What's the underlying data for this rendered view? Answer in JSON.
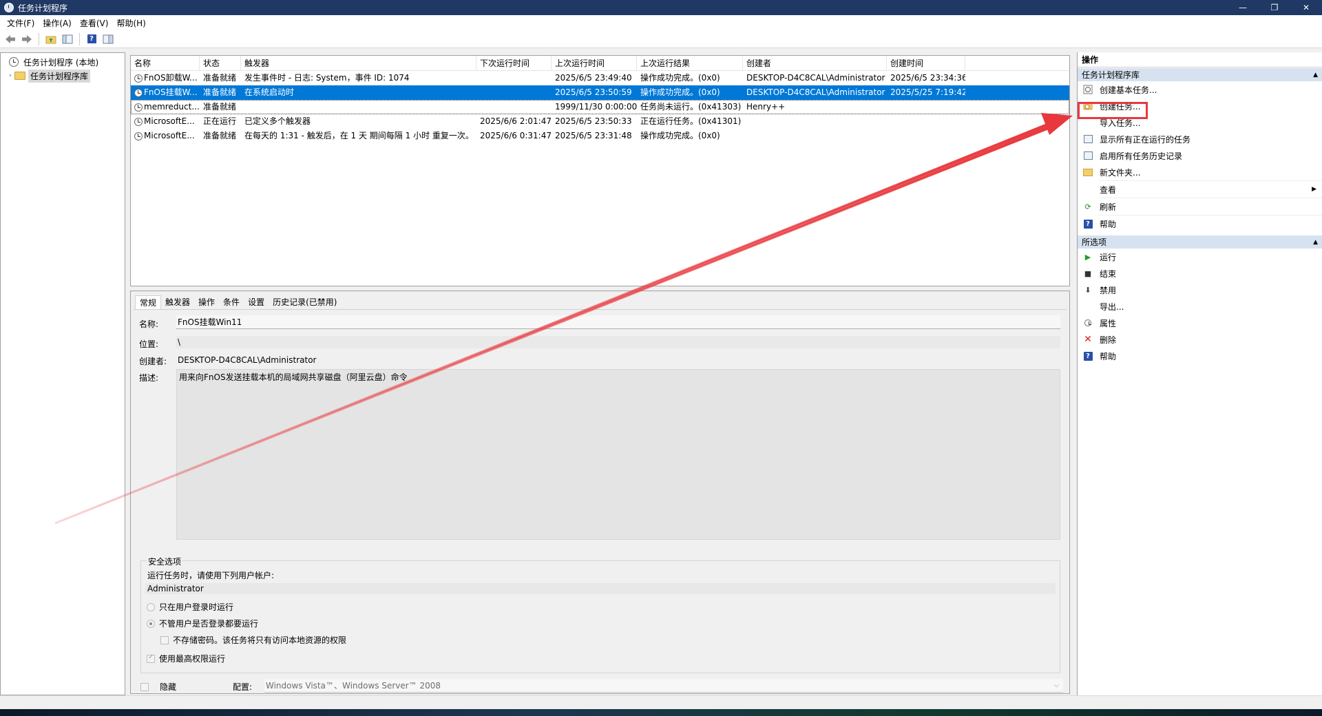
{
  "window": {
    "title": "任务计划程序",
    "minimize": "—",
    "restore": "❐",
    "close": "✕"
  },
  "menu": [
    "文件(F)",
    "操作(A)",
    "查看(V)",
    "帮助(H)"
  ],
  "tree": {
    "root": "任务计划程序 (本地)",
    "library": "任务计划程序库"
  },
  "task_list": {
    "columns": [
      "名称",
      "状态",
      "触发器",
      "下次运行时间",
      "上次运行时间",
      "上次运行结果",
      "创建者",
      "创建时间"
    ],
    "rows": [
      [
        "FnOS卸载W...",
        "准备就绪",
        "发生事件时 - 日志: System，事件 ID: 1074",
        "",
        "2025/6/5 23:49:40",
        "操作成功完成。(0x0)",
        "DESKTOP-D4C8CAL\\Administrator",
        "2025/6/5 23:34:36"
      ],
      [
        "FnOS挂载W...",
        "准备就绪",
        "在系统启动时",
        "",
        "2025/6/5 23:50:59",
        "操作成功完成。(0x0)",
        "DESKTOP-D4C8CAL\\Administrator",
        "2025/5/25 7:19:42"
      ],
      [
        "memreduct...",
        "准备就绪",
        "",
        "",
        "1999/11/30 0:00:00",
        "任务尚未运行。(0x41303)",
        "Henry++",
        ""
      ],
      [
        "MicrosoftE...",
        "正在运行",
        "已定义多个触发器",
        "2025/6/6 2:01:47",
        "2025/6/5 23:50:33",
        "正在运行任务。(0x41301)",
        "",
        ""
      ],
      [
        "MicrosoftE...",
        "准备就绪",
        "在每天的 1:31 - 触发后，在 1 天 期间每隔 1 小时 重复一次。",
        "2025/6/6 0:31:47",
        "2025/6/5 23:31:48",
        "操作成功完成。(0x0)",
        "",
        ""
      ]
    ]
  },
  "detail": {
    "tabs": [
      "常规",
      "触发器",
      "操作",
      "条件",
      "设置",
      "历史记录(已禁用)"
    ],
    "name_label": "名称:",
    "name_value": "FnOS挂载Win11",
    "location_label": "位置:",
    "location_value": "\\",
    "author_label": "创建者:",
    "author_value": "DESKTOP-D4C8CAL\\Administrator",
    "desc_label": "描述:",
    "desc_value": "用来向FnOS发送挂载本机的局域网共享磁盘（阿里云盘）命令",
    "security": {
      "title": "安全选项",
      "account_prompt": "运行任务时，请使用下列用户帐户:",
      "account": "Administrator",
      "opt_logged_on": "只在用户登录时运行",
      "opt_whether_logged": "不管用户是否登录都要运行",
      "opt_no_password": "不存储密码。该任务将只有访问本地资源的权限",
      "opt_highest": "使用最高权限运行"
    },
    "hidden_label": "隐藏",
    "config_label": "配置:",
    "config_value": "Windows Vista™、Windows Server™ 2008"
  },
  "actions": {
    "title": "操作",
    "library_section": "任务计划程序库",
    "library_items": [
      "创建基本任务...",
      "创建任务...",
      "导入任务...",
      "显示所有正在运行的任务",
      "启用所有任务历史记录",
      "新文件夹...",
      "查看",
      "刷新",
      "帮助"
    ],
    "selected_section": "所选项",
    "selected_items": [
      "运行",
      "结束",
      "禁用",
      "导出...",
      "属性",
      "删除",
      "帮助"
    ]
  },
  "colors": {
    "titlebar": "#1f3864",
    "selection": "#0078d7",
    "section_header": "#d6e2f0",
    "annotation": "#e8383d"
  }
}
